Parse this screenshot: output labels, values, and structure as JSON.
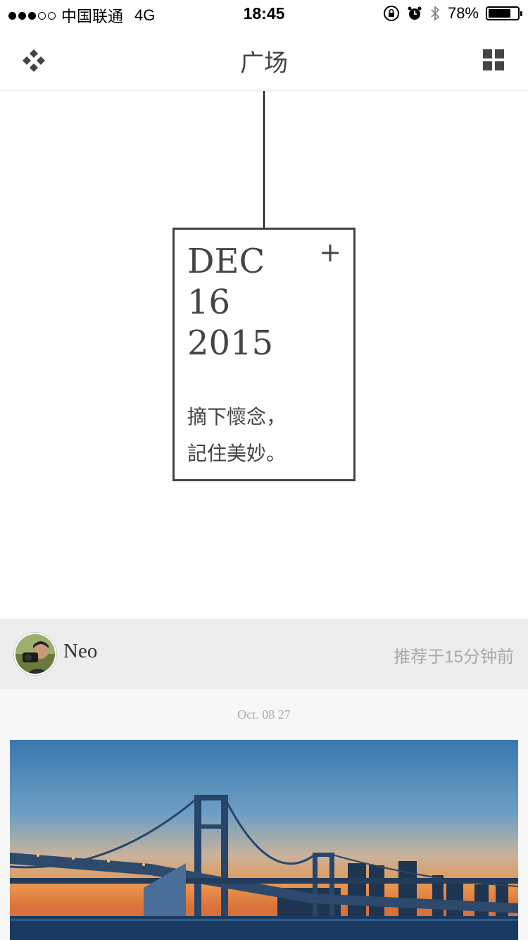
{
  "status_bar": {
    "carrier": "中国联通",
    "network": "4G",
    "time": "18:45",
    "battery": "78%",
    "battery_level": 0.78
  },
  "nav": {
    "title": "广场",
    "left_icon": "diamond-grid-icon",
    "right_icon": "grid-icon"
  },
  "date_card": {
    "month": "DEC",
    "day": "16",
    "year": "2015",
    "caption_line1": "摘下懷念，",
    "caption_line2": "記住美妙。"
  },
  "post": {
    "username": "Neo",
    "recommended": "推荐于15分钟前",
    "date": "Oct. 08 27",
    "image": "bridge-sunset-photo"
  },
  "colors": {
    "accent": "#444444",
    "header_bg": "#ededed",
    "muted_text": "#aaaaaa"
  }
}
